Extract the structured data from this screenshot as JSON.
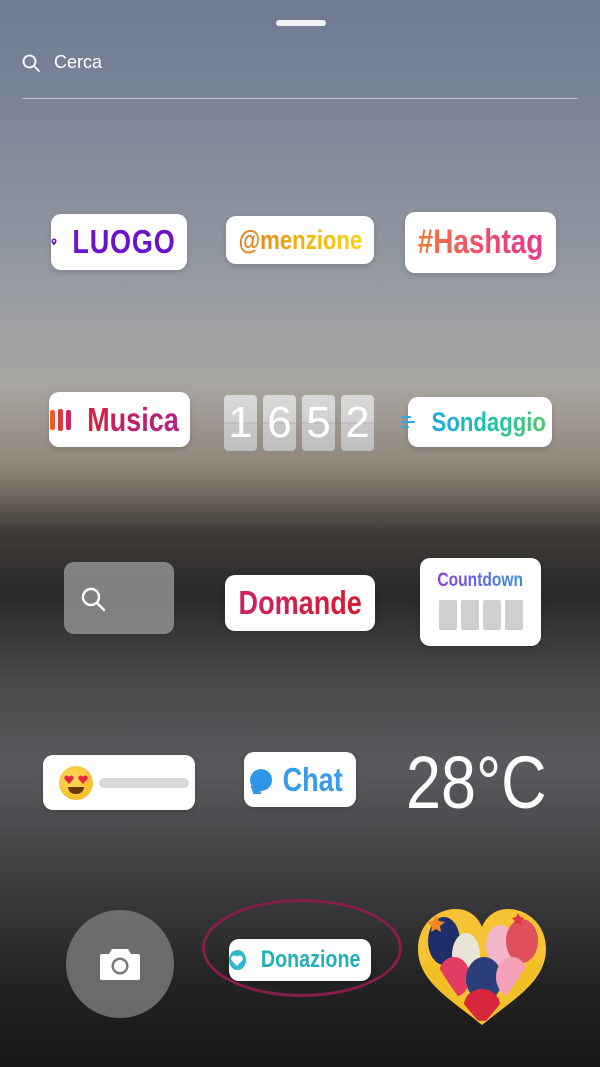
{
  "search": {
    "placeholder": "Cerca"
  },
  "stickers": {
    "location": "LUOGO",
    "mention": "@menzione",
    "hashtag": "#Hashtag",
    "music": "Musica",
    "clock_digits": [
      "1",
      "6",
      "5",
      "2"
    ],
    "poll": "Sondaggio",
    "questions": "Domande",
    "countdown": "Countdown",
    "chat": "Chat",
    "temperature": "28°C",
    "donation": "Donazione"
  },
  "icons": {
    "search": "search-icon",
    "location": "location-pin-icon",
    "music": "music-bars-icon",
    "poll": "poll-lines-icon",
    "chat": "chat-bubble-icon",
    "camera": "camera-icon",
    "donation": "heart-icon"
  },
  "colors": {
    "highlight_circle": "#861e4a",
    "location_purple": "#6c13c9",
    "chat_blue": "#3a9be6",
    "donation_teal": "#22b0b8"
  }
}
